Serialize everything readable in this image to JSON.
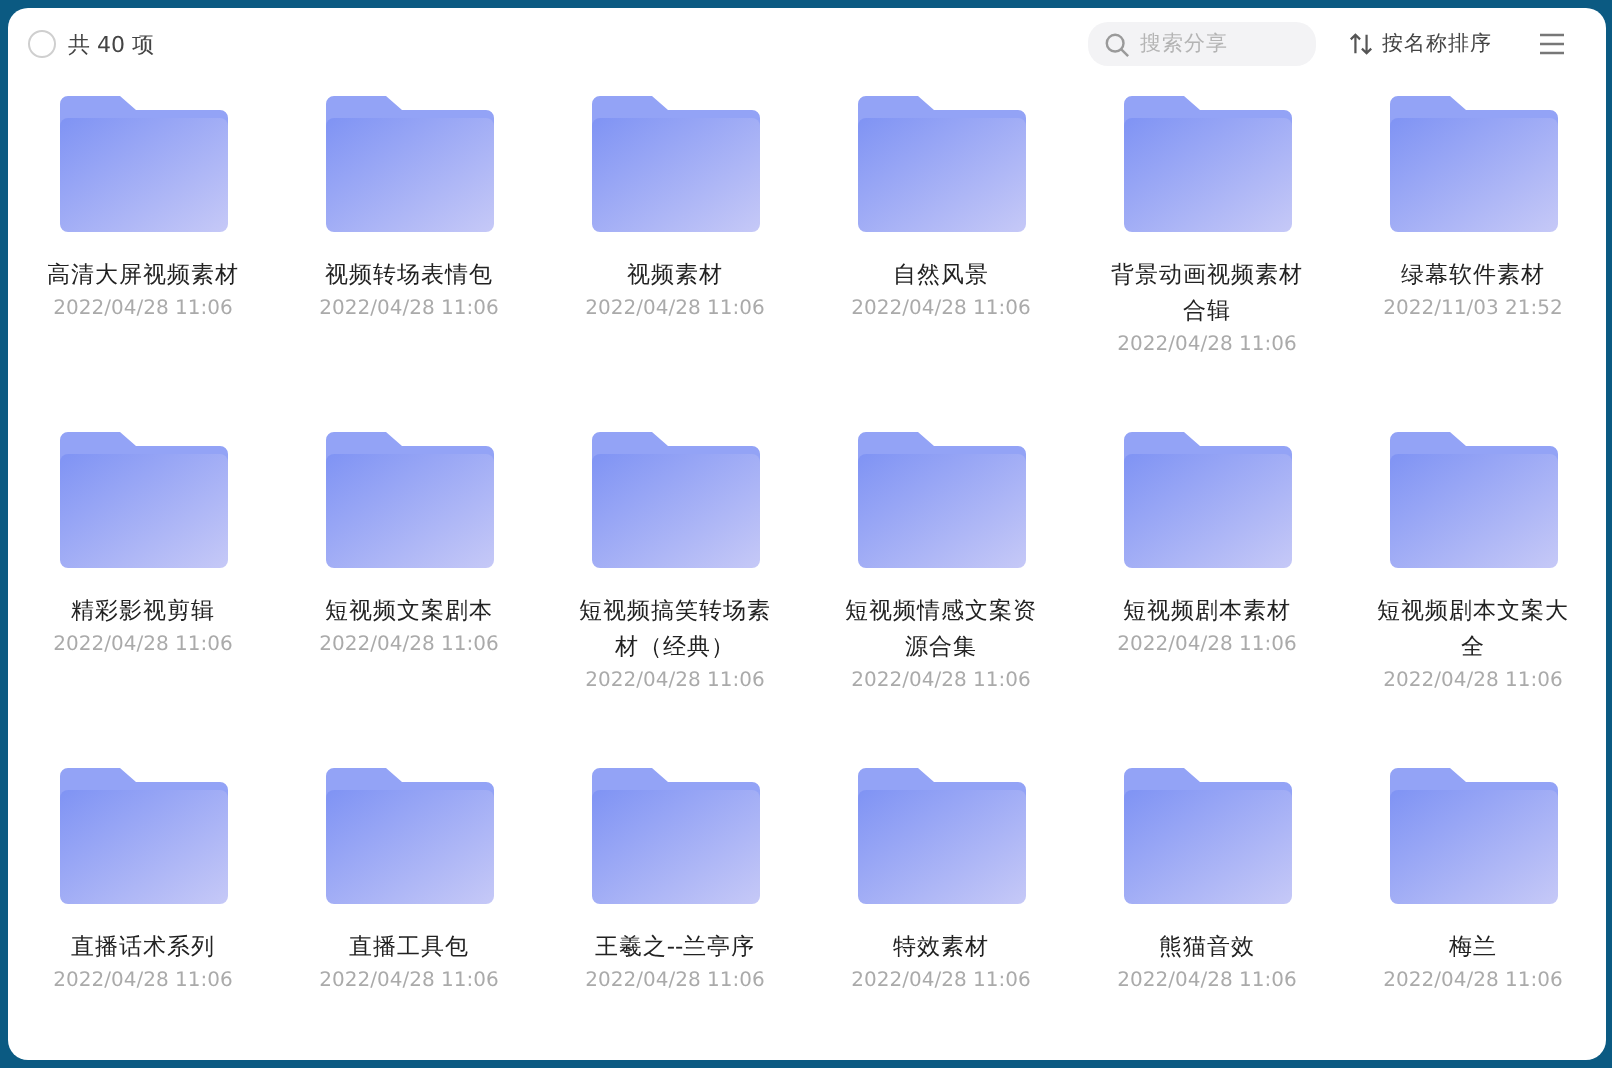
{
  "header": {
    "select_all": {
      "checked": false
    },
    "count": "共 40 项",
    "search": {
      "placeholder": "搜索分享"
    },
    "sort": "按名称排序"
  },
  "folders": [
    {
      "name": "高清大屏视频素材",
      "date": "2022/04/28 11:06"
    },
    {
      "name": "视频转场表情包",
      "date": "2022/04/28 11:06"
    },
    {
      "name": "视频素材",
      "date": "2022/04/28 11:06"
    },
    {
      "name": "自然风景",
      "date": "2022/04/28 11:06"
    },
    {
      "name": "背景动画视频素材合辑",
      "date": "2022/04/28 11:06"
    },
    {
      "name": "绿幕软件素材",
      "date": "2022/11/03 21:52"
    },
    {
      "name": "精彩影视剪辑",
      "date": "2022/04/28 11:06"
    },
    {
      "name": "短视频文案剧本",
      "date": "2022/04/28 11:06"
    },
    {
      "name": "短视频搞笑转场素材（经典）",
      "date": "2022/04/28 11:06"
    },
    {
      "name": "短视频情感文案资源合集",
      "date": "2022/04/28 11:06"
    },
    {
      "name": "短视频剧本素材",
      "date": "2022/04/28 11:06"
    },
    {
      "name": "短视频剧本文案大全",
      "date": "2022/04/28 11:06"
    },
    {
      "name": "直播话术系列",
      "date": "2022/04/28 11:06"
    },
    {
      "name": "直播工具包",
      "date": "2022/04/28 11:06"
    },
    {
      "name": "王羲之--兰亭序",
      "date": "2022/04/28 11:06"
    },
    {
      "name": "特效素材",
      "date": "2022/04/28 11:06"
    },
    {
      "name": "熊猫音效",
      "date": "2022/04/28 11:06"
    },
    {
      "name": "梅兰",
      "date": "2022/04/28 11:06"
    }
  ]
}
